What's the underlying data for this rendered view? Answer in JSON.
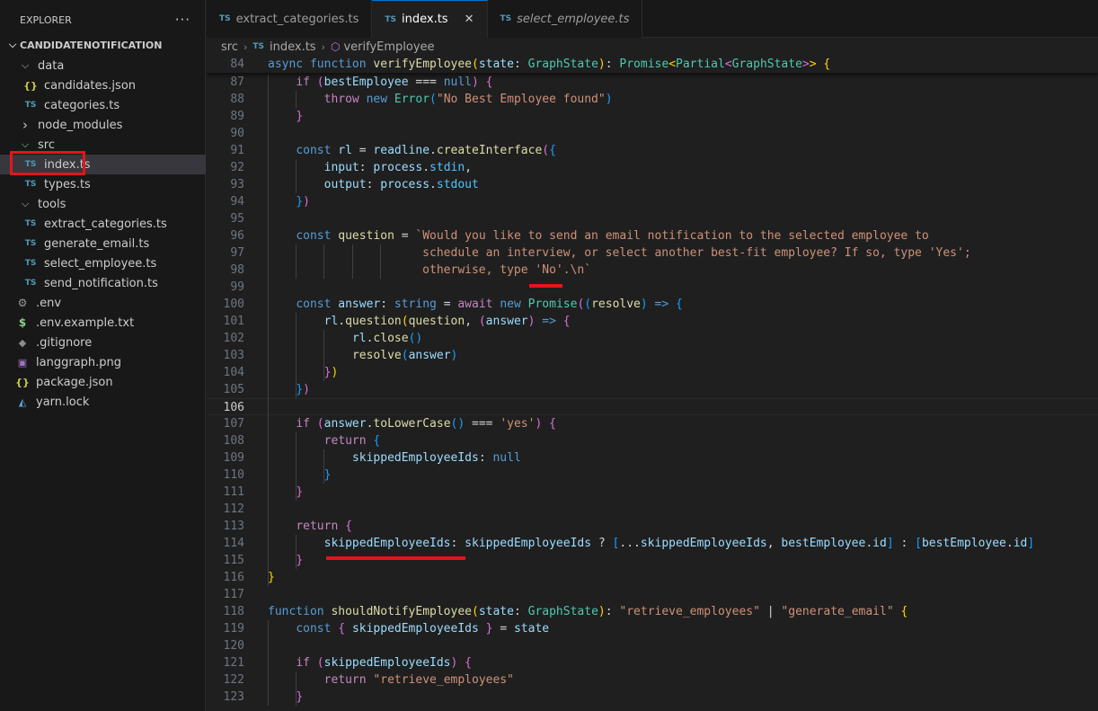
{
  "explorer": {
    "title": "EXPLORER",
    "more": "···",
    "root": "CANDIDATENOTIFICATION",
    "items": [
      {
        "label": "data",
        "kind": "folder",
        "icon": "chevron-down-icon"
      },
      {
        "label": "candidates.json",
        "kind": "json",
        "icon": "json-file-icon",
        "badge": "{}"
      },
      {
        "label": "categories.ts",
        "kind": "ts",
        "icon": "typescript-file-icon",
        "badge": "TS"
      },
      {
        "label": "node_modules",
        "kind": "folder-closed",
        "icon": "chevron-right-icon"
      },
      {
        "label": "src",
        "kind": "folder",
        "icon": "chevron-down-icon"
      },
      {
        "label": "index.ts",
        "kind": "ts",
        "icon": "typescript-file-icon",
        "badge": "TS"
      },
      {
        "label": "types.ts",
        "kind": "ts",
        "icon": "typescript-file-icon",
        "badge": "TS"
      },
      {
        "label": "tools",
        "kind": "folder",
        "icon": "chevron-down-icon"
      },
      {
        "label": "extract_categories.ts",
        "kind": "ts",
        "icon": "typescript-file-icon",
        "badge": "TS"
      },
      {
        "label": "generate_email.ts",
        "kind": "ts",
        "icon": "typescript-file-icon",
        "badge": "TS"
      },
      {
        "label": "select_employee.ts",
        "kind": "ts",
        "icon": "typescript-file-icon",
        "badge": "TS"
      },
      {
        "label": "send_notification.ts",
        "kind": "ts",
        "icon": "typescript-file-icon",
        "badge": "TS"
      },
      {
        "label": ".env",
        "kind": "env",
        "icon": "gear-icon"
      },
      {
        "label": ".env.example.txt",
        "kind": "env",
        "icon": "dollar-icon",
        "badge": "$"
      },
      {
        "label": ".gitignore",
        "kind": "git",
        "icon": "git-icon"
      },
      {
        "label": "langgraph.png",
        "kind": "image",
        "icon": "image-icon"
      },
      {
        "label": "package.json",
        "kind": "json",
        "icon": "json-file-icon",
        "badge": "{}"
      },
      {
        "label": "yarn.lock",
        "kind": "yarn",
        "icon": "yarn-icon"
      }
    ]
  },
  "tabs": [
    {
      "label": "extract_categories.ts",
      "badge": "TS",
      "active": false,
      "italic": false
    },
    {
      "label": "index.ts",
      "badge": "TS",
      "active": true,
      "italic": false,
      "close": "✕"
    },
    {
      "label": "select_employee.ts",
      "badge": "TS",
      "active": false,
      "italic": true
    }
  ],
  "breadcrumb": {
    "folder": "src",
    "file": "index.ts",
    "file_badge": "TS",
    "symbol": "verifyEmployee"
  },
  "editor": {
    "current_line": "106",
    "lines": [
      {
        "n": "84",
        "text": "async function verifyEmployee(state: GraphState): Promise<Partial<GraphState>> {"
      },
      {
        "n": "87",
        "text": "    if (bestEmployee === null) {"
      },
      {
        "n": "88",
        "text": "        throw new Error(\"No Best Employee found\")"
      },
      {
        "n": "89",
        "text": "    }"
      },
      {
        "n": "90",
        "text": ""
      },
      {
        "n": "91",
        "text": "    const rl = readline.createInterface({"
      },
      {
        "n": "92",
        "text": "        input: process.stdin,"
      },
      {
        "n": "93",
        "text": "        output: process.stdout"
      },
      {
        "n": "94",
        "text": "    })"
      },
      {
        "n": "95",
        "text": ""
      },
      {
        "n": "96",
        "text": "    const question = `Would you like to send an email notification to the selected employee to"
      },
      {
        "n": "97",
        "text": "                      schedule an interview, or select another best-fit employee? If so, type 'Yes';"
      },
      {
        "n": "98",
        "text": "                      otherwise, type 'No'.\\n`"
      },
      {
        "n": "99",
        "text": ""
      },
      {
        "n": "100",
        "text": "    const answer: string = await new Promise((resolve) => {"
      },
      {
        "n": "101",
        "text": "        rl.question(question, (answer) => {"
      },
      {
        "n": "102",
        "text": "            rl.close()"
      },
      {
        "n": "103",
        "text": "            resolve(answer)"
      },
      {
        "n": "104",
        "text": "        })"
      },
      {
        "n": "105",
        "text": "    })"
      },
      {
        "n": "106",
        "text": ""
      },
      {
        "n": "107",
        "text": "    if (answer.toLowerCase() === 'yes') {"
      },
      {
        "n": "108",
        "text": "        return {"
      },
      {
        "n": "109",
        "text": "            skippedEmployeeIds: null"
      },
      {
        "n": "110",
        "text": "        }"
      },
      {
        "n": "111",
        "text": "    }"
      },
      {
        "n": "112",
        "text": ""
      },
      {
        "n": "113",
        "text": "    return {"
      },
      {
        "n": "114",
        "text": "        skippedEmployeeIds: skippedEmployeeIds ? [...skippedEmployeeIds, bestEmployee.id] : [bestEmployee.id]"
      },
      {
        "n": "115",
        "text": "    }"
      },
      {
        "n": "116",
        "text": "}"
      },
      {
        "n": "117",
        "text": ""
      },
      {
        "n": "118",
        "text": "function shouldNotifyEmployee(state: GraphState): \"retrieve_employees\" | \"generate_email\" {"
      },
      {
        "n": "119",
        "text": "    const { skippedEmployeeIds } = state"
      },
      {
        "n": "120",
        "text": ""
      },
      {
        "n": "121",
        "text": "    if (skippedEmployeeIds) {"
      },
      {
        "n": "122",
        "text": "        return \"retrieve_employees\""
      },
      {
        "n": "123",
        "text": "    }"
      }
    ]
  },
  "colors": {
    "highlight_red": "#e5141c",
    "accent": "#0078d4",
    "ts_blue": "#519aba"
  }
}
